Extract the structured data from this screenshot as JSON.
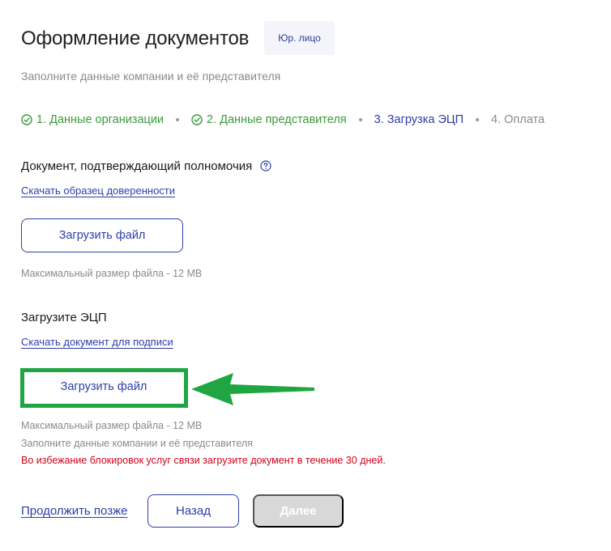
{
  "header": {
    "title": "Оформление документов",
    "badge": "Юр. лицо",
    "subtitle": "Заполните данные компании и её представителя"
  },
  "stepper": {
    "steps": [
      {
        "label": "1. Данные организации",
        "state": "done"
      },
      {
        "label": "2. Данные представителя",
        "state": "done"
      },
      {
        "label": "3. Загрузка ЭЦП",
        "state": "active"
      },
      {
        "label": "4. Оплата",
        "state": "pending"
      }
    ]
  },
  "section_power": {
    "title": "Документ, подтверждающий полномочия",
    "help_icon": "question-circle-icon",
    "link": "Скачать образец доверенности",
    "upload_label": "Загрузить файл",
    "hint": "Максимальный размер файла - 12 MB"
  },
  "section_ecp": {
    "title": "Загрузите ЭЦП",
    "link": "Скачать документ для подписи",
    "upload_label": "Загрузить файл",
    "hint": "Максимальный размер файла - 12 MB",
    "hint2": "Заполните данные компании и её представителя",
    "warning": "Во избежание блокировок услуг связи загрузите документ в течение 30 дней."
  },
  "footer": {
    "later_label": "Продолжить позже",
    "back_label": "Назад",
    "next_label": "Далее"
  },
  "colors": {
    "primary": "#2d3ea8",
    "done": "#3c9a3c",
    "warning": "#d0021b",
    "annotation": "#1fa542",
    "disabled": "#d8d8d8"
  }
}
